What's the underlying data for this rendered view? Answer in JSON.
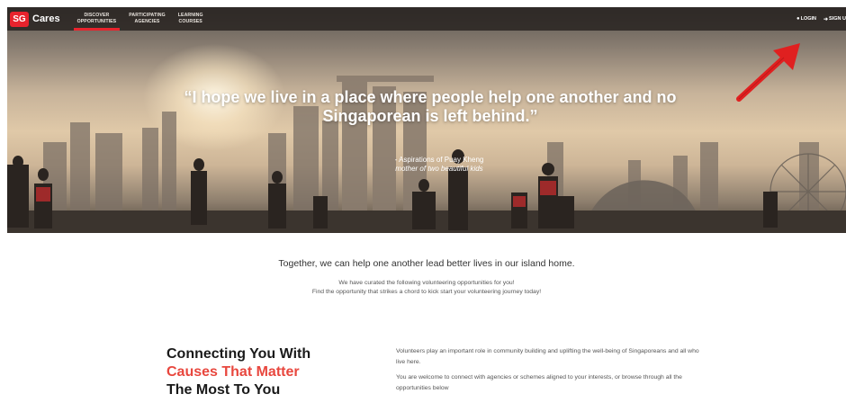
{
  "nav": {
    "logo_sg": "SG",
    "logo_cares": "Cares",
    "tabs": [
      {
        "line1": "DISCOVER",
        "line2": "OPPORTUNITIES"
      },
      {
        "line1": "PARTICIPATING",
        "line2": "AGENCIES"
      },
      {
        "line1": "LEARNING",
        "line2": "COURSES"
      }
    ],
    "login_label": "LOGIN",
    "signup_label": "SIGN U"
  },
  "hero": {
    "quote": "“I hope we live in a place where people help one another and no Singaporean is left behind.”",
    "attribution": "- Aspirations of Puay Kheng",
    "attribution_sub": "mother of two beautiful kids"
  },
  "tagline": "Together, we can help one another lead better lives in our island home.",
  "intro": {
    "line1": "We have curated the following volunteering opportunities for you!",
    "line2": "Find the opportunity that strikes a chord to kick start your volunteering journey today!"
  },
  "section": {
    "heading_line1": "Connecting You With",
    "heading_accent": "Causes That Matter",
    "heading_line3": "The Most To You",
    "para1": "Volunteers play an important role in community building and uplifting the well-being of Singaporeans and all who live here.",
    "para2": "You are welcome to connect with agencies or schemes aligned to your interests, or browse through all the opportunities below"
  },
  "colors": {
    "brand_red": "#e8232d",
    "accent": "#e8473e",
    "annotation_arrow": "#e02020"
  },
  "icons": {
    "login": "user-icon",
    "signup": "sign-in-icon"
  }
}
